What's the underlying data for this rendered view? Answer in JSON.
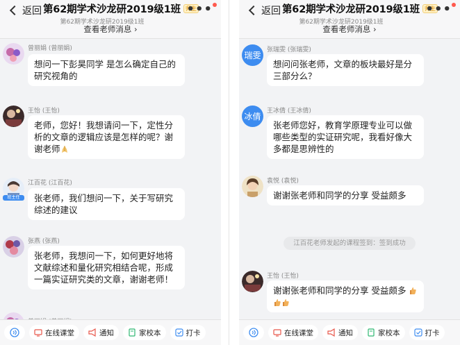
{
  "header": {
    "back_label": "返回",
    "title": "第62期学术沙龙研2019级1班",
    "badge": "师生",
    "subtitle": "第62期学术沙龙研2019级1班",
    "view_teacher_messages": "查看老师消息 ›"
  },
  "left_messages": [
    {
      "sender": "曾丽娟 (曾丽娟)",
      "text": "想问一下彭昊同学 是怎么确定自己的研究视角的"
    },
    {
      "sender": "王怡 (王怡)",
      "text": "老师，您好！我想请问一下，定性分析的文章的逻辑应该是怎样的呢？谢谢老师"
    },
    {
      "sender": "江百花 (江百花)",
      "text": "张老师，我们想问一下，关于写研究综述的建议",
      "avatar_tag": "班主任"
    },
    {
      "sender": "张燕 (张燕)",
      "text": "张老师，我想问一下，如何更好地将文献综述和量化研究相结合呢，形成一篇实证研究类的文章，谢谢老师！"
    },
    {
      "sender": "曾丽娟 (曾丽娟)"
    }
  ],
  "right_messages": [
    {
      "sender": "张瑞雯 (张瑞雯)",
      "avatar_text": "瑞雯",
      "text": "想问问张老师，文章的板块最好是分三部分么？"
    },
    {
      "sender": "王冰倩 (王冰倩)",
      "avatar_text": "冰倩",
      "text": "张老师您好，教育学原理专业可以做哪些类型的实证研究呢，我看好像大多都是思辨性的"
    },
    {
      "sender": "袁悦 (袁悦)",
      "text": "谢谢张老师和同学的分享 受益颇多"
    },
    {
      "sender": "王怡 (王怡)",
      "text": "谢谢张老师和同学的分享 受益颇多"
    }
  ],
  "system_notice": "江百花老师发起的课程签到：签到成功",
  "toolbar": {
    "online_class": "在线课堂",
    "notice": "通知",
    "homework": "家校本",
    "checkin": "打卡"
  },
  "colors": {
    "accent": "#3d8cf0",
    "toolbar_icon": "#e8574b",
    "background": "#f2f3f5"
  }
}
